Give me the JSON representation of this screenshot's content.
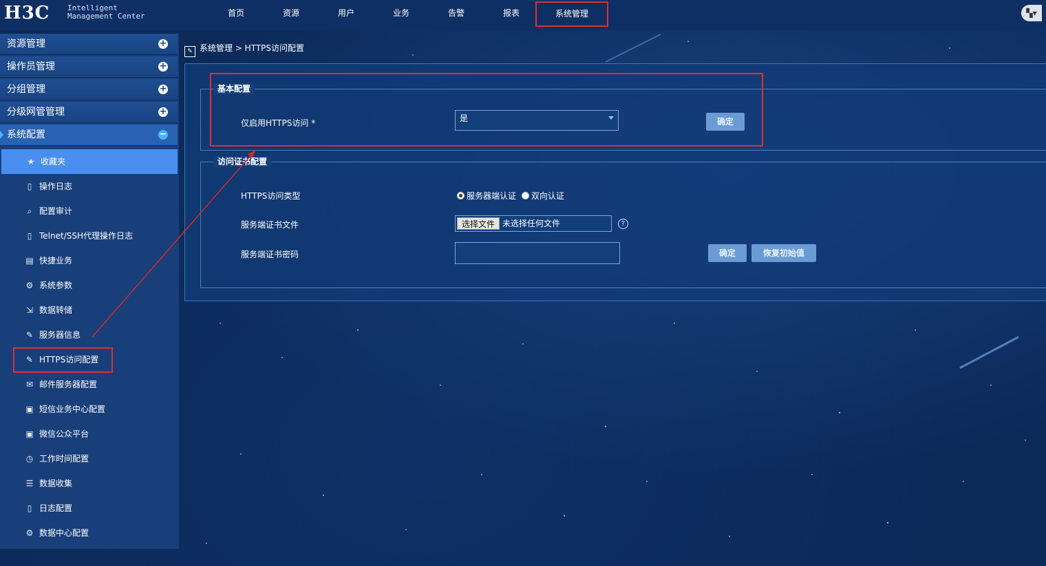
{
  "header": {
    "logo": "H3C",
    "logo_sub_line1": "Intelligent",
    "logo_sub_line2": "Management Center",
    "nav": [
      "首页",
      "资源",
      "用户",
      "业务",
      "告警",
      "报表",
      "系统管理"
    ],
    "active_nav": "系统管理",
    "right_icon": "window-switch-icon"
  },
  "sidebar": {
    "categories": [
      {
        "label": "资源管理",
        "state": "+"
      },
      {
        "label": "操作员管理",
        "state": "+"
      },
      {
        "label": "分组管理",
        "state": "+"
      },
      {
        "label": "分级网管管理",
        "state": "+"
      },
      {
        "label": "系统配置",
        "state": "−"
      }
    ],
    "items": [
      {
        "label": "收藏夹",
        "icon": "star-icon"
      },
      {
        "label": "操作日志",
        "icon": "clipboard-icon"
      },
      {
        "label": "配置审计",
        "icon": "search-icon"
      },
      {
        "label": "Telnet/SSH代理操作日志",
        "icon": "clipboard-icon"
      },
      {
        "label": "快捷业务",
        "icon": "id-card-icon"
      },
      {
        "label": "系统参数",
        "icon": "gear-icon"
      },
      {
        "label": "数据转储",
        "icon": "export-icon"
      },
      {
        "label": "服务器信息",
        "icon": "edit-icon"
      },
      {
        "label": "HTTPS访问配置",
        "icon": "edit-icon"
      },
      {
        "label": "邮件服务器配置",
        "icon": "mail-server-icon"
      },
      {
        "label": "短信业务中心配置",
        "icon": "sms-icon"
      },
      {
        "label": "微信公众平台",
        "icon": "wechat-icon"
      },
      {
        "label": "工作时间配置",
        "icon": "clock-icon"
      },
      {
        "label": "数据收集",
        "icon": "list-icon"
      },
      {
        "label": "日志配置",
        "icon": "log-icon"
      },
      {
        "label": "数据中心配置",
        "icon": "gear-icon"
      }
    ]
  },
  "breadcrumb": "系统管理 > HTTPS访问配置",
  "basic": {
    "legend": "基本配置",
    "https_only_label": "仅启用HTTPS访问 *",
    "https_only_value": "是",
    "confirm": "确定"
  },
  "cert": {
    "legend": "访问证书配置",
    "type_label": "HTTPS访问类型",
    "type_option1": "服务器端认证",
    "type_option2": "双向认证",
    "file_label": "服务端证书文件",
    "file_button": "选择文件",
    "file_status": "未选择任何文件",
    "help": "?",
    "pwd_label": "服务端证书密码",
    "confirm": "确定",
    "reset": "恢复初始值"
  }
}
